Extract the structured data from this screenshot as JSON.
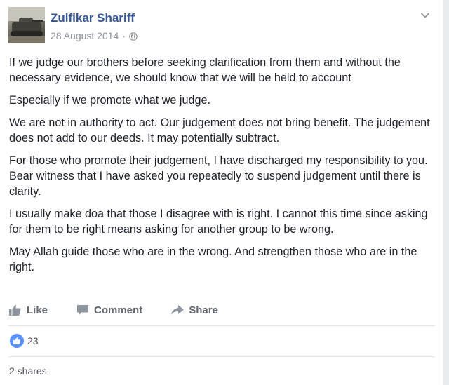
{
  "post": {
    "author": "Zulfikar Shariff",
    "date": "28 August 2014",
    "separator": "·",
    "privacy_icon": "globe-icon",
    "menu_icon": "chevron-down-icon",
    "paragraphs": [
      "If we judge our brothers before seeking clarification from them and without the necessary evidence, we should know that we will be held to account",
      "Especially if we promote what we judge.",
      "We are not in authority to act. Our judgement does not bring benefit. The judgement does not add to our deeds. It may potentially subtract.",
      "For those who promote their judgement, I have discharged my responsibility to you. Bear witness that I have asked you repeatedly to suspend judgement until there is clarity.",
      "I usually make doa that those I disagree with is right. I cannot this time since asking for them to be right means asking for another group to be wrong.",
      "May Allah guide those who are in the wrong. And strengthen those who are in the right."
    ]
  },
  "actions": {
    "like_label": "Like",
    "comment_label": "Comment",
    "share_label": "Share"
  },
  "reactions": {
    "count": "23",
    "accent": "#5890ff"
  },
  "shares": {
    "label": "2 shares"
  },
  "colors": {
    "author_link": "#365899",
    "muted": "#90949c",
    "action_text": "#616770"
  }
}
